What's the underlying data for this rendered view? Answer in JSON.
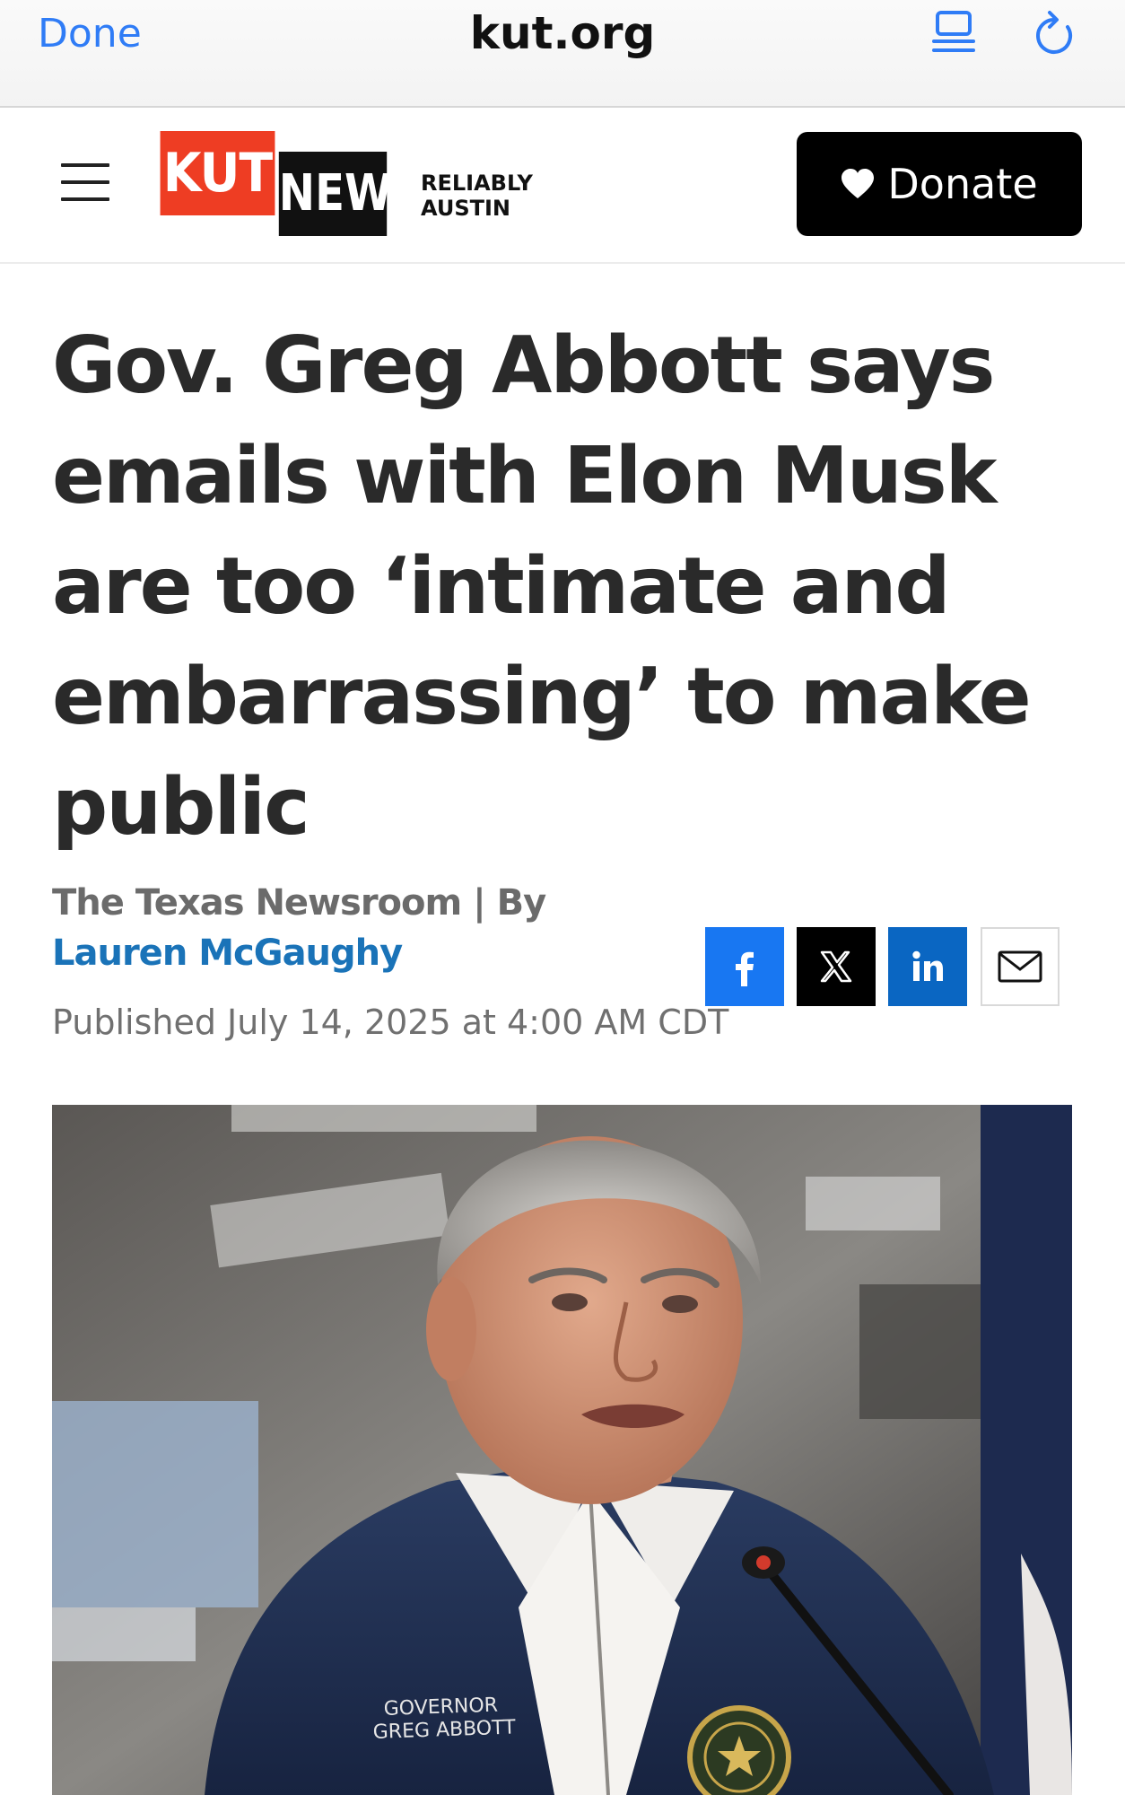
{
  "browser": {
    "done_label": "Done",
    "url": "kut.org"
  },
  "header": {
    "logo_kut": "KUT",
    "logo_news": "NEWS",
    "tagline_line1": "RELIABLY",
    "tagline_line2": "AUSTIN",
    "donate_label": "Donate"
  },
  "article": {
    "headline": "Gov. Greg Abbott says emails with Elon Musk are too ‘intimate and embarrassing’ to make public",
    "source": "The Texas Newsroom | By ",
    "author": "Lauren McGaughy",
    "published": "Published July 14, 2025 at 4:00 AM CDT",
    "share": [
      "facebook-share",
      "x-share",
      "linkedin-share",
      "email-share"
    ],
    "photo": {
      "jacket_text_line1": "GOVERNOR",
      "jacket_text_line2": "GREG ABBOTT"
    }
  },
  "colors": {
    "link_blue": "#2f7cf6",
    "kut_red": "#ee3d23",
    "author_blue": "#1a73b8",
    "facebook": "#1877f2",
    "linkedin": "#0a66c2"
  }
}
